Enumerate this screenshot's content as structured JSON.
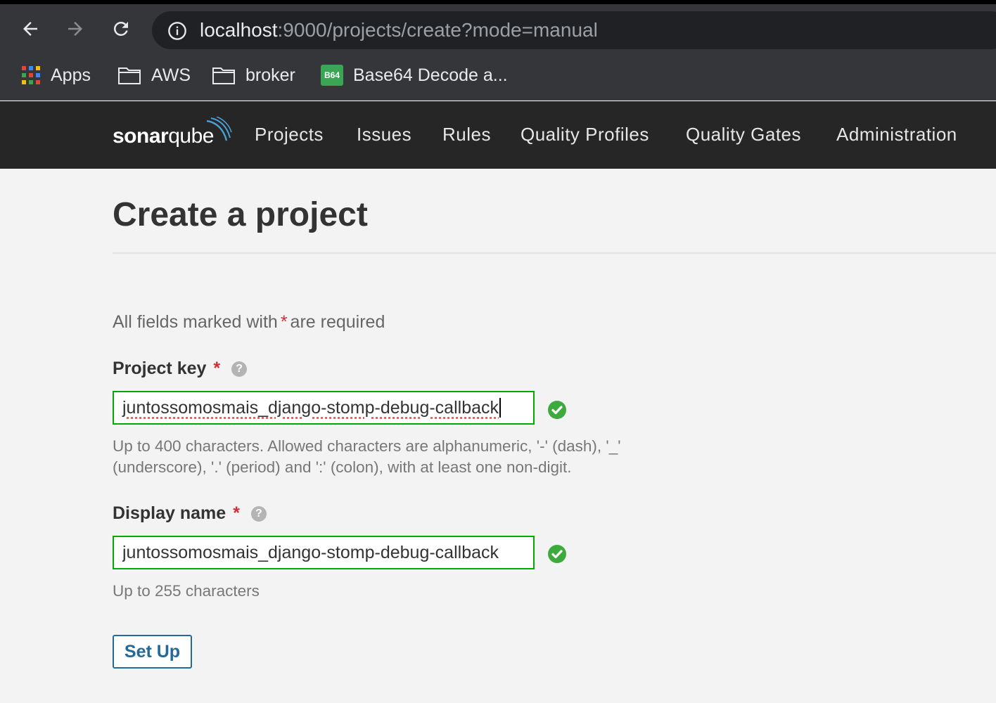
{
  "browser": {
    "url_host": "localhost",
    "url_rest": ":9000/projects/create?mode=manual",
    "bookmarks": [
      {
        "label": "Apps",
        "icon": "apps-grid-icon"
      },
      {
        "label": "AWS",
        "icon": "folder-icon"
      },
      {
        "label": "broker",
        "icon": "folder-icon"
      },
      {
        "label": "Base64 Decode a...",
        "icon": "b64-icon",
        "icon_text": "B64"
      }
    ]
  },
  "sonar": {
    "logo_bold": "sonar",
    "logo_light": "qube",
    "nav": [
      "Projects",
      "Issues",
      "Rules",
      "Quality Profiles",
      "Quality Gates",
      "Administration"
    ]
  },
  "page": {
    "title": "Create a project",
    "required_note_before": "All fields marked with",
    "required_star": "*",
    "required_note_after": "are required"
  },
  "form": {
    "project_key": {
      "label": "Project key",
      "value": "juntossomosmais_django-stomp-debug-callback",
      "help": "Up to 400 characters. Allowed characters are alphanumeric, '-' (dash), '_' (underscore), '.' (period) and ':' (colon), with at least one non-digit."
    },
    "display_name": {
      "label": "Display name",
      "value": "juntossomosmais_django-stomp-debug-callback",
      "help": "Up to 255 characters"
    },
    "help_icon_glyph": "?",
    "submit_label": "Set Up"
  },
  "colors": {
    "valid_green": "#00aa00",
    "accent_blue": "#236a97",
    "required_red": "#d02f3a"
  }
}
